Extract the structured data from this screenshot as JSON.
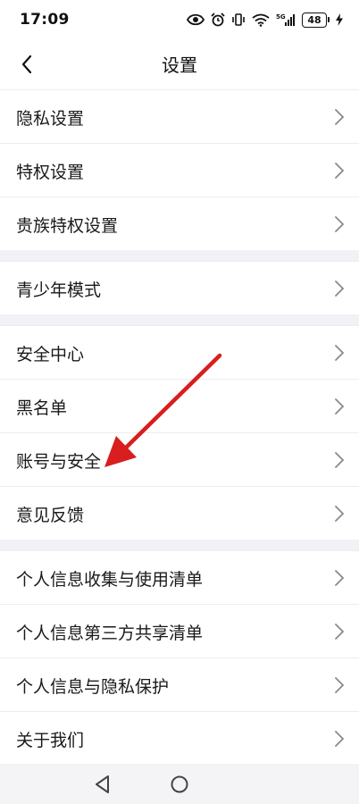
{
  "status_bar": {
    "time": "17:09",
    "battery": "48",
    "icons": [
      "eye-icon",
      "alarm-icon",
      "vibrate-icon",
      "wifi-icon",
      "5g-signal-icon",
      "battery-icon",
      "charging-icon"
    ]
  },
  "header": {
    "title": "设置",
    "back_icon": "chevron-left-icon"
  },
  "settings": {
    "groups": [
      {
        "items": [
          {
            "label": "隐私设置"
          },
          {
            "label": "特权设置"
          },
          {
            "label": "贵族特权设置"
          }
        ]
      },
      {
        "items": [
          {
            "label": "青少年模式"
          }
        ]
      },
      {
        "items": [
          {
            "label": "安全中心"
          },
          {
            "label": "黑名单"
          },
          {
            "label": "账号与安全"
          },
          {
            "label": "意见反馈"
          }
        ]
      },
      {
        "items": [
          {
            "label": "个人信息收集与使用清单"
          },
          {
            "label": "个人信息第三方共享清单"
          },
          {
            "label": "个人信息与隐私保护"
          },
          {
            "label": "关于我们"
          }
        ]
      }
    ]
  },
  "annotation": {
    "type": "red-arrow",
    "color": "#d81e1e"
  },
  "bottom_nav": {
    "icons": [
      "nav-back-icon",
      "nav-home-icon"
    ]
  },
  "colors": {
    "background": "#ffffff",
    "separator": "#f2f2f6",
    "chevron": "#8a8a8a",
    "text": "#1a1a1a"
  }
}
